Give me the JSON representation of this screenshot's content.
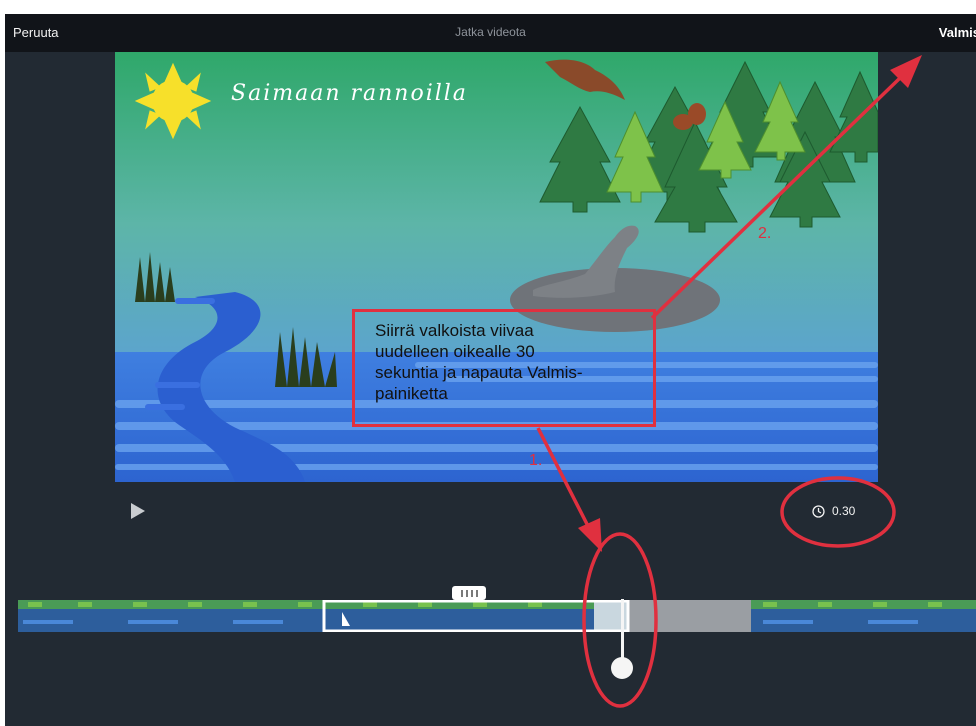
{
  "topbar": {
    "cancel_label": "Peruuta",
    "title": "Jatka videota",
    "done_label": "Valmis"
  },
  "preview": {
    "slide_title": "Saimaan rannoilla"
  },
  "player": {
    "duration": "0.30"
  },
  "annotation": {
    "instruction_lines": [
      "Siirrä valkoista viivaa",
      "uudelleen oikealle 30",
      "sekuntia ja napauta Valmis-",
      "painiketta"
    ],
    "step1_label": "1.",
    "step2_label": "2."
  },
  "colors": {
    "annotation_red": "#e0303f",
    "app_background": "#222a33",
    "topbar_background": "#111419"
  },
  "icons": [
    "play-icon",
    "clock-icon"
  ]
}
